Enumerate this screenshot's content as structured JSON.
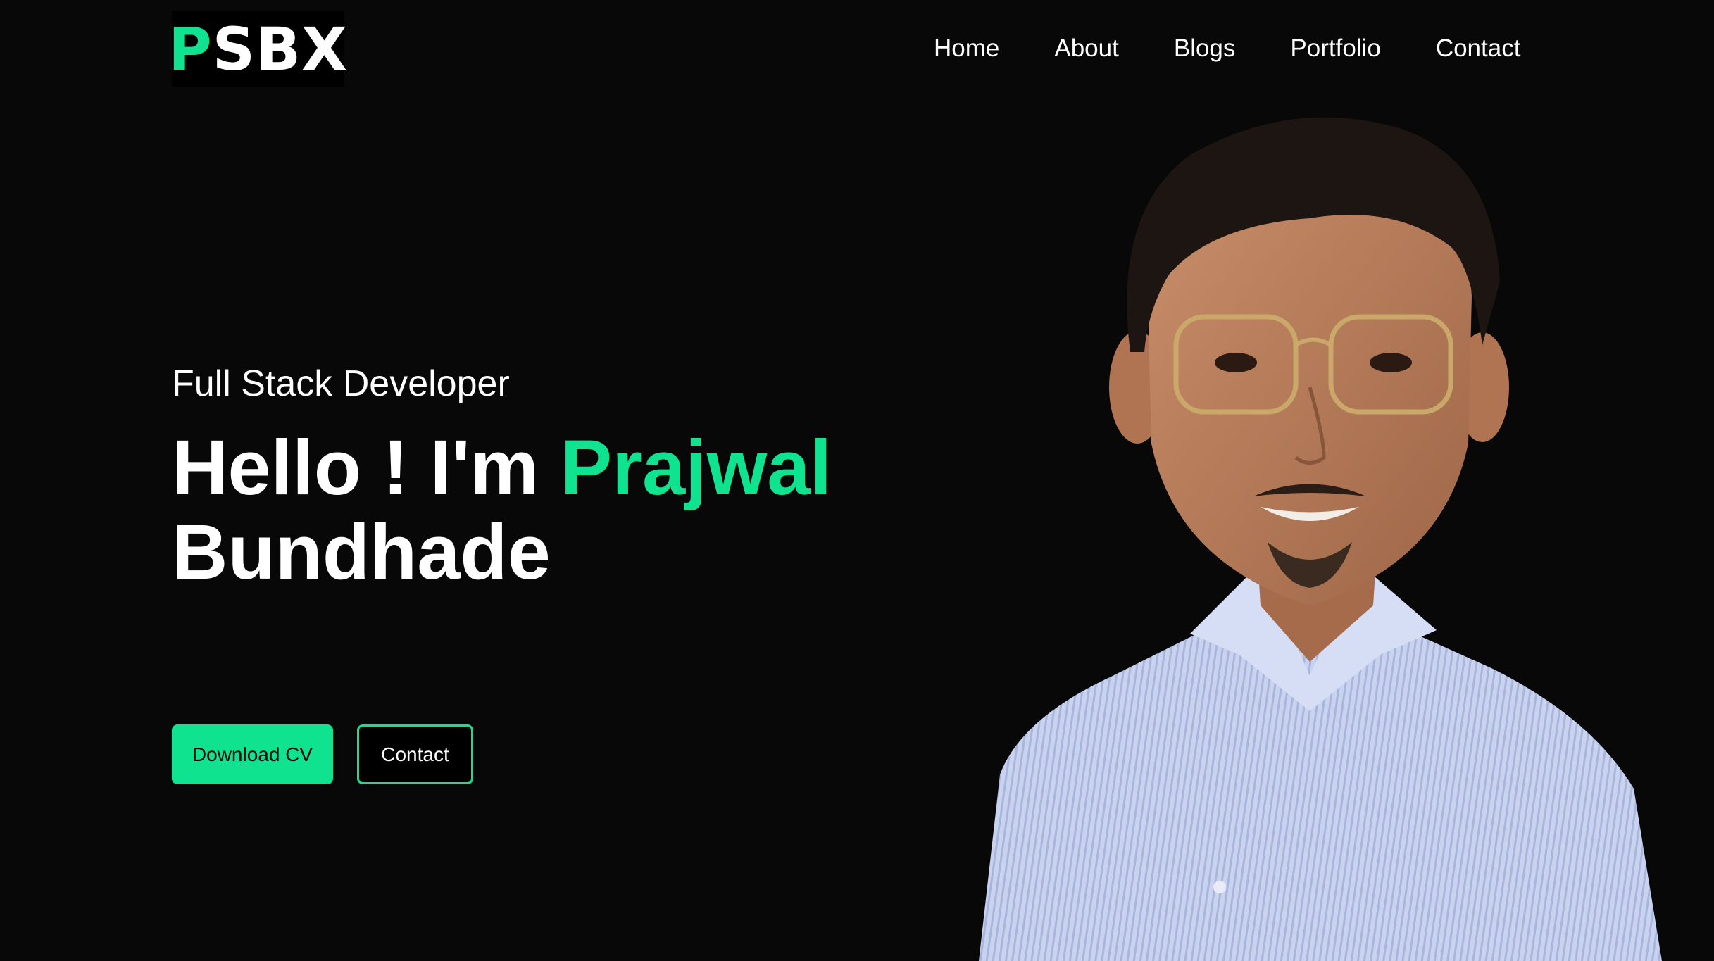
{
  "header": {
    "logo": {
      "accent": "P",
      "rest": "SBX"
    },
    "nav": [
      {
        "label": "Home"
      },
      {
        "label": "About"
      },
      {
        "label": "Blogs"
      },
      {
        "label": "Portfolio"
      },
      {
        "label": "Contact"
      }
    ]
  },
  "hero": {
    "role": "Full Stack Developer",
    "greeting": "Hello ! I'm",
    "first_name": "Prajwal",
    "last_name": "Bundhade",
    "buttons": {
      "download_cv": "Download CV",
      "contact": "Contact"
    }
  },
  "colors": {
    "accent": "#10e38f",
    "background": "#080808"
  },
  "icons": {
    "portrait": "person-photo"
  }
}
